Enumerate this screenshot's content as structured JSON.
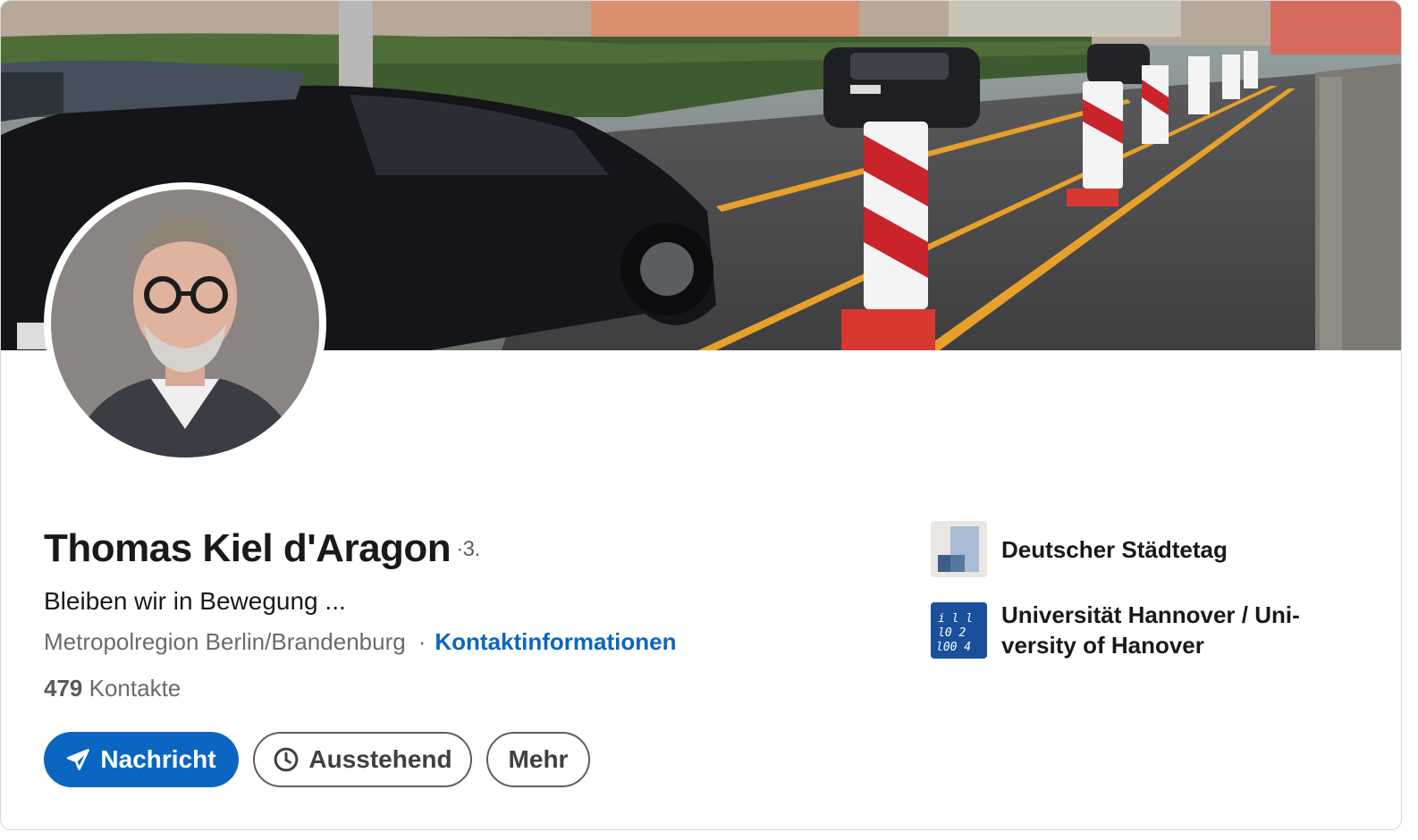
{
  "profile": {
    "name": "Thomas Kiel d'Aragon",
    "degree": "·3.",
    "headline": "Bleiben wir in Bewegung ...",
    "location": "Metropolregion Berlin/Brandenburg",
    "separator": "·",
    "contact_info_label": "Kontaktinformationen",
    "connections_count": "479",
    "connections_label": "Kontakte"
  },
  "actions": {
    "message_label": "Nachricht",
    "pending_label": "Ausstehend",
    "more_label": "Mehr"
  },
  "organizations": [
    {
      "name": "Deutscher Städtetag",
      "logo_icon": "staedtetag-logo"
    },
    {
      "name": "Universität Hannover / Uni-versity of Hanover",
      "logo_icon": "uni-hannover-logo"
    }
  ],
  "colors": {
    "accent": "#0a66c2",
    "text_primary": "#191919",
    "text_secondary": "#6b6b6b"
  }
}
